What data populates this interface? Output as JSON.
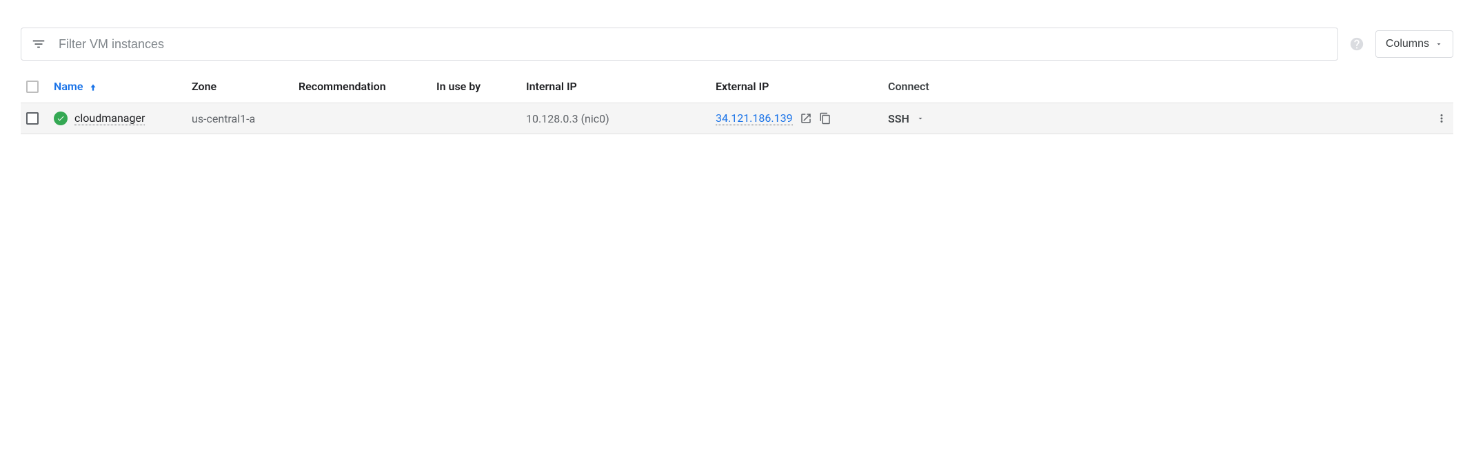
{
  "filter": {
    "placeholder": "Filter VM instances"
  },
  "columnsButton": {
    "label": "Columns"
  },
  "headers": {
    "name": "Name",
    "zone": "Zone",
    "recommendation": "Recommendation",
    "inUseBy": "In use by",
    "internalIp": "Internal IP",
    "externalIp": "External IP",
    "connect": "Connect"
  },
  "row": {
    "name": "cloudmanager",
    "zone": "us-central1-a",
    "recommendation": "",
    "inUseBy": "",
    "internalIp": "10.128.0.3",
    "internalNic": "(nic0)",
    "externalIp": "34.121.186.139",
    "sshLabel": "SSH"
  }
}
